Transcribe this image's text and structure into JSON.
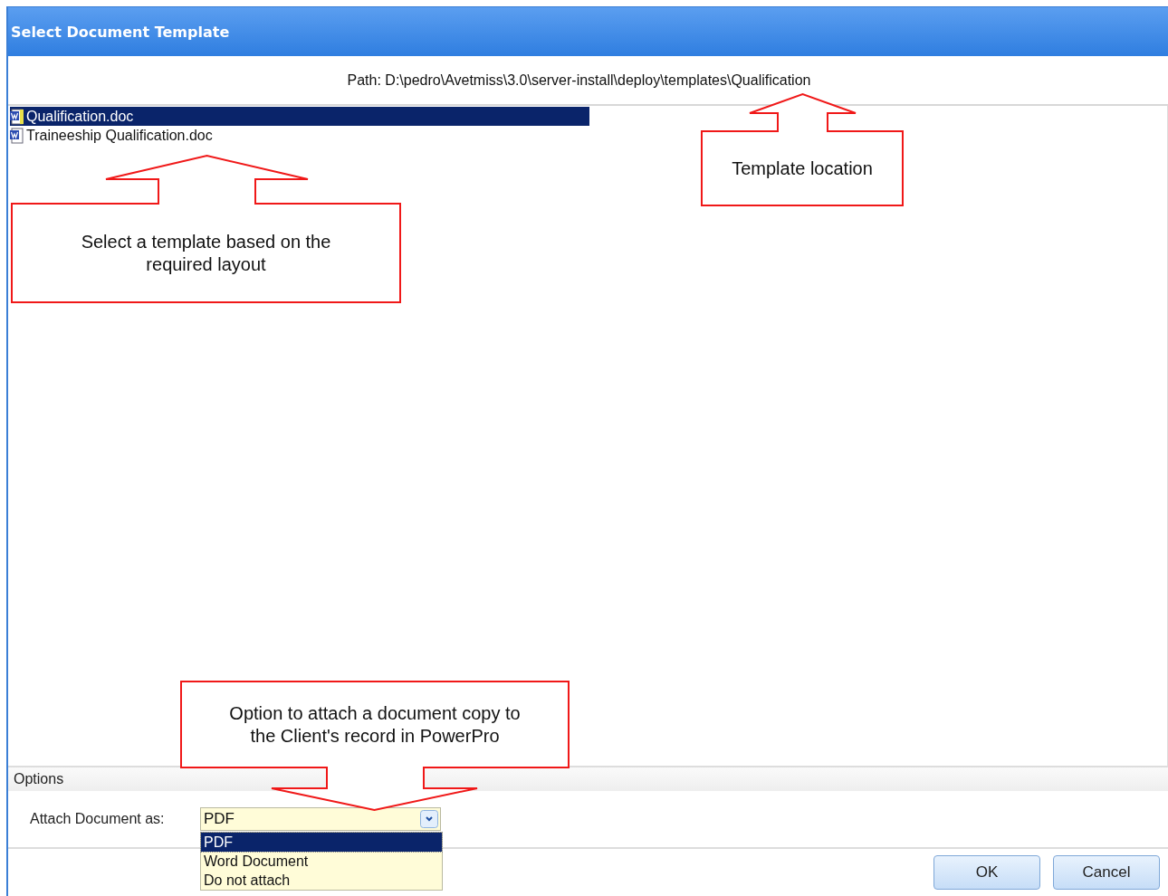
{
  "window": {
    "title": "Select Document Template"
  },
  "path": "Path: D:\\pedro\\Avetmiss\\3.0\\server-install\\deploy\\templates\\Qualification",
  "files": [
    {
      "name": "Qualification.doc",
      "selected": true
    },
    {
      "name": "Traineeship Qualification.doc",
      "selected": false
    }
  ],
  "options": {
    "heading": "Options",
    "attach_label": "Attach Document as:",
    "attach_value": "PDF",
    "dropdown_open": true,
    "dropdown_items": [
      {
        "label": "PDF",
        "selected": true
      },
      {
        "label": "Word Document",
        "selected": false
      },
      {
        "label": "Do not attach",
        "selected": false
      }
    ]
  },
  "buttons": [
    "OK",
    "Cancel"
  ],
  "annotations": [
    {
      "text": "Template location"
    },
    {
      "text": "Select a template based on the required layout"
    },
    {
      "text": "Option to attach a document copy to the Client's record in PowerPro"
    }
  ]
}
